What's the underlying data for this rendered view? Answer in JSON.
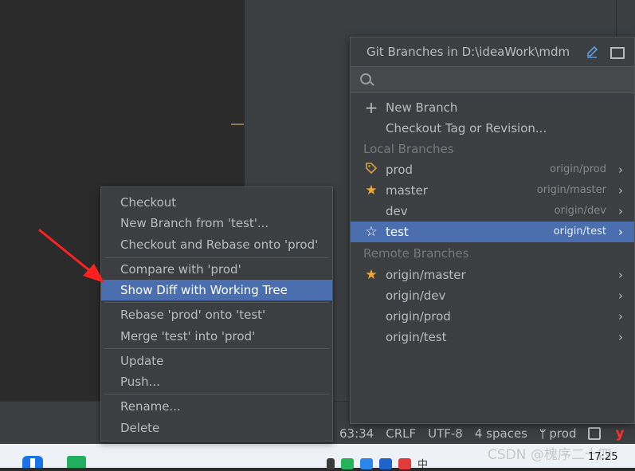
{
  "git_popup": {
    "title": "Git Branches in D:\\ideaWork\\mdm",
    "search_placeholder": "",
    "actions": [
      {
        "label": "New Branch",
        "icon": "plus-icon"
      },
      {
        "label": "Checkout Tag or Revision...",
        "icon": ""
      }
    ],
    "local_header": "Local Branches",
    "local": [
      {
        "label": "prod",
        "tracking": "origin/prod",
        "icon": "tag-icon"
      },
      {
        "label": "master",
        "tracking": "origin/master",
        "icon": "star-filled-icon"
      },
      {
        "label": "dev",
        "tracking": "origin/dev",
        "icon": ""
      },
      {
        "label": "test",
        "tracking": "origin/test",
        "icon": "star-outline-icon",
        "selected": true
      }
    ],
    "remote_header": "Remote Branches",
    "remote": [
      {
        "label": "origin/master",
        "icon": "star-filled-icon"
      },
      {
        "label": "origin/dev",
        "icon": ""
      },
      {
        "label": "origin/prod",
        "icon": ""
      },
      {
        "label": "origin/test",
        "icon": ""
      }
    ],
    "chevron": "›"
  },
  "context_menu": {
    "items": [
      "Checkout",
      "New Branch from 'test'...",
      "Checkout and Rebase onto 'prod'",
      "Compare with 'prod'",
      "Show Diff with Working Tree",
      "Rebase 'prod' onto 'test'",
      "Merge 'test' into 'prod'",
      "Update",
      "Push...",
      "Rename...",
      "Delete"
    ],
    "selected_index": 4
  },
  "status_bar": {
    "position": "63:34",
    "line_sep": "CRLF",
    "encoding": "UTF-8",
    "indent": "4 spaces",
    "branch": "prod",
    "y_icon_label": "y"
  },
  "taskbar": {
    "clock": "17:25",
    "watermark": "CSDN @槐序二十四",
    "tray_text": "中"
  },
  "colors": {
    "selection": "#4b6eaf",
    "arrow": "#ff2020",
    "star": "#f0a732"
  }
}
